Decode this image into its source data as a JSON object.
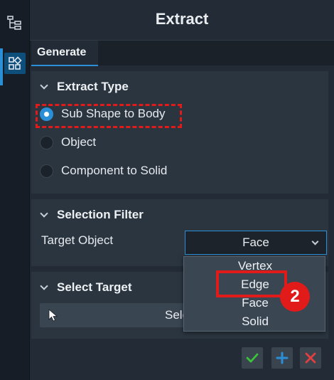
{
  "panel": {
    "title": "Extract"
  },
  "tabs": [
    {
      "label": "Generate"
    }
  ],
  "extract_type": {
    "header": "Extract Type",
    "options": [
      {
        "label": "Sub Shape to Body",
        "selected": true
      },
      {
        "label": "Object",
        "selected": false
      },
      {
        "label": "Component to Solid",
        "selected": false
      }
    ]
  },
  "selection_filter": {
    "header": "Selection Filter",
    "target_label": "Target Object",
    "target_value": "Face",
    "dropdown_options": [
      "Vertex",
      "Edge",
      "Face",
      "Solid"
    ]
  },
  "select_target": {
    "header": "Select Target",
    "button_label": "Sele"
  },
  "annotation": {
    "step": "2"
  },
  "icons": {
    "strip": [
      "tree-icon",
      "features-icon"
    ],
    "footer": [
      "check-icon",
      "plus-icon",
      "close-icon"
    ]
  },
  "colors": {
    "accent": "#2a8fd6",
    "highlight_red": "#e11a1a",
    "ok_green": "#3cc33c",
    "add_blue": "#2a8fd6",
    "cancel_red": "#e04040"
  }
}
